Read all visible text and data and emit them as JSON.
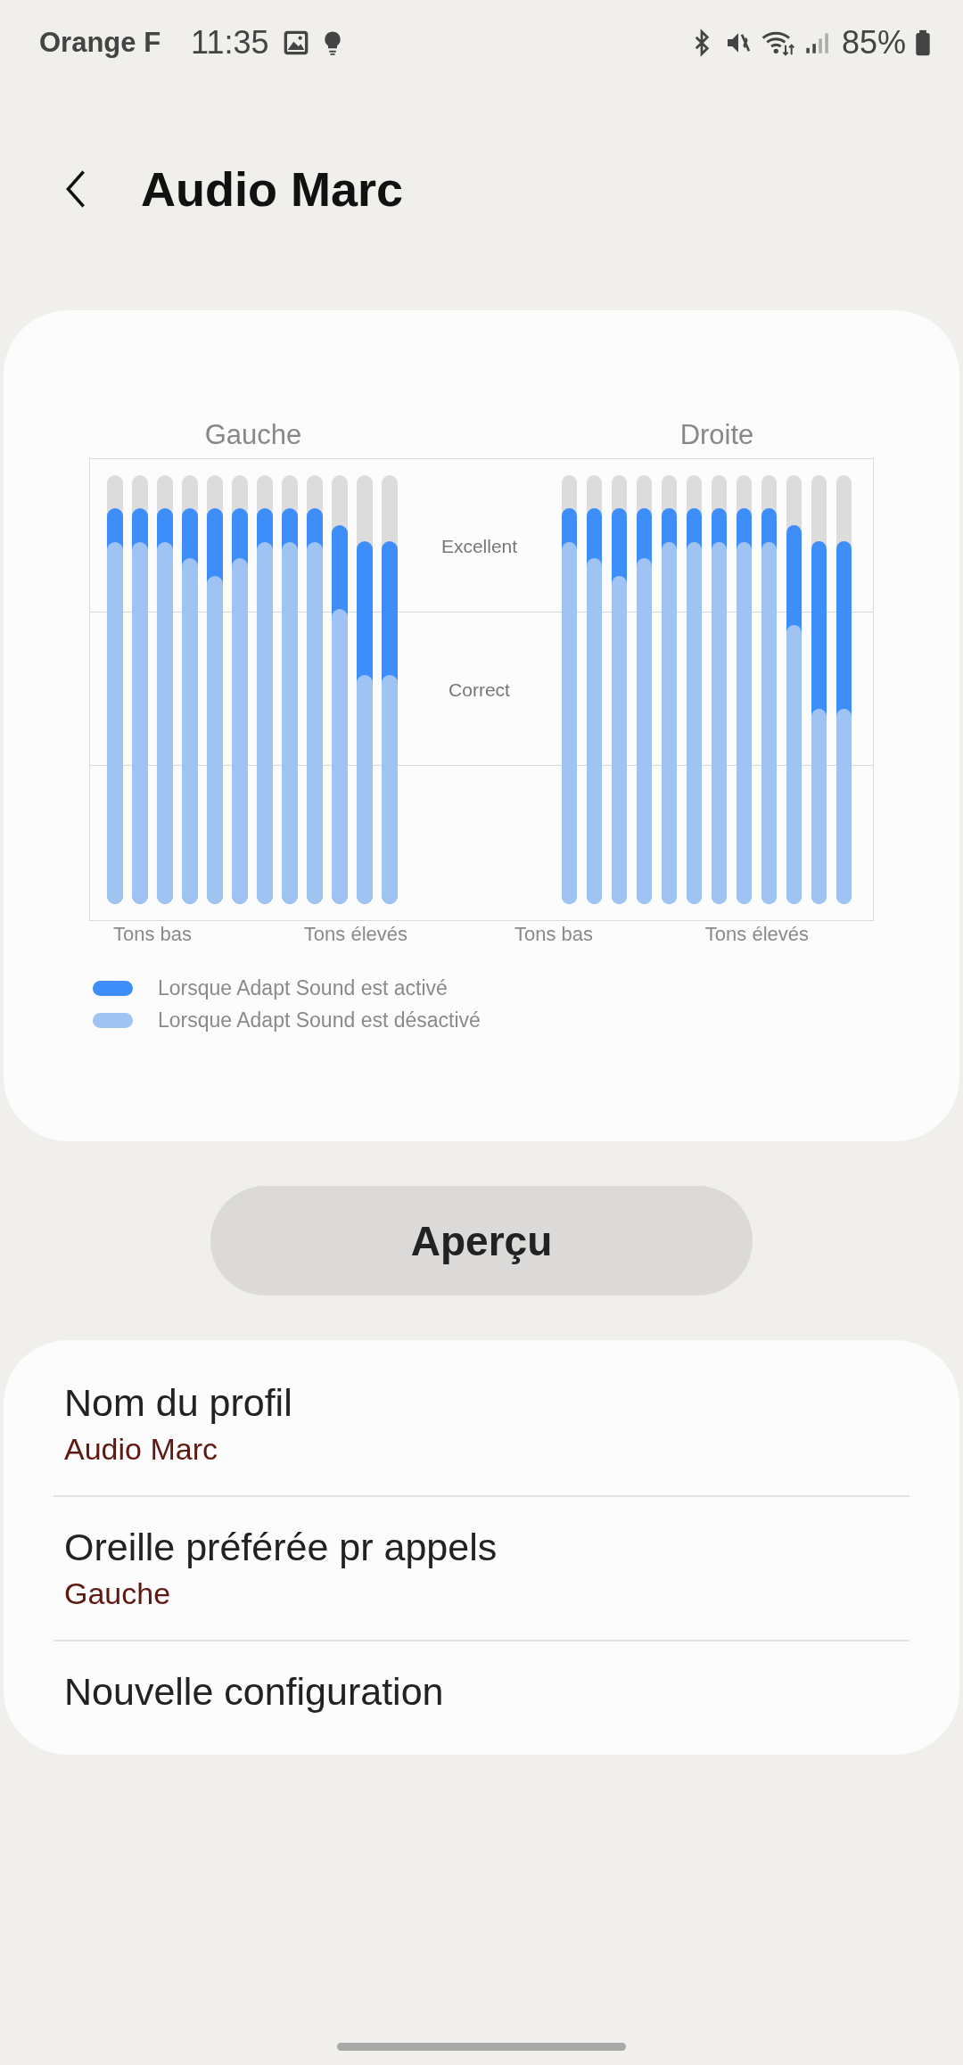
{
  "status_bar": {
    "carrier": "Orange F",
    "time": "11:35",
    "battery": "85%"
  },
  "header": {
    "title": "Audio Marc"
  },
  "hearing_chart": {
    "band_labels": [
      "Excellent",
      "Correct"
    ],
    "ears": [
      {
        "title": "Gauche",
        "low_label": "Tons bas",
        "high_label": "Tons élevés",
        "active": [
          {
            "level": 0.923
          },
          {
            "level": 0.923
          },
          {
            "level": 0.923
          },
          {
            "level": 0.923
          },
          {
            "level": 0.923
          },
          {
            "level": 0.923
          },
          {
            "level": 0.923
          },
          {
            "level": 0.923
          },
          {
            "level": 0.923
          },
          {
            "level": 0.884
          },
          {
            "level": 0.846
          },
          {
            "level": 0.846
          }
        ],
        "inactive": [
          {
            "level": 0.844
          },
          {
            "level": 0.844
          },
          {
            "level": 0.844
          },
          {
            "level": 0.806
          },
          {
            "level": 0.766
          },
          {
            "level": 0.806
          },
          {
            "level": 0.844
          },
          {
            "level": 0.844
          },
          {
            "level": 0.844
          },
          {
            "level": 0.689
          },
          {
            "level": 0.534
          },
          {
            "level": 0.534
          }
        ]
      },
      {
        "title": "Droite",
        "low_label": "Tons bas",
        "high_label": "Tons élevés",
        "active": [
          {
            "level": 0.923
          },
          {
            "level": 0.923
          },
          {
            "level": 0.923
          },
          {
            "level": 0.923
          },
          {
            "level": 0.923
          },
          {
            "level": 0.923
          },
          {
            "level": 0.923
          },
          {
            "level": 0.923
          },
          {
            "level": 0.923
          },
          {
            "level": 0.884
          },
          {
            "level": 0.846
          },
          {
            "level": 0.846
          }
        ],
        "inactive": [
          {
            "level": 0.844
          },
          {
            "level": 0.806
          },
          {
            "level": 0.766
          },
          {
            "level": 0.806
          },
          {
            "level": 0.844
          },
          {
            "level": 0.844
          },
          {
            "level": 0.844
          },
          {
            "level": 0.844
          },
          {
            "level": 0.844
          },
          {
            "level": 0.65
          },
          {
            "level": 0.456
          },
          {
            "level": 0.456
          }
        ]
      }
    ],
    "legend": [
      {
        "label": "Lorsque Adapt Sound est activé",
        "color": "#3d8ef8"
      },
      {
        "label": "Lorsque Adapt Sound est désactivé",
        "color": "#9fc3f2"
      }
    ]
  },
  "preview_button": "Aperçu",
  "settings": [
    {
      "title": "Nom du profil",
      "value": "Audio Marc"
    },
    {
      "title": "Oreille préférée pr appels",
      "value": "Gauche"
    },
    {
      "title": "Nouvelle configuration"
    }
  ]
}
